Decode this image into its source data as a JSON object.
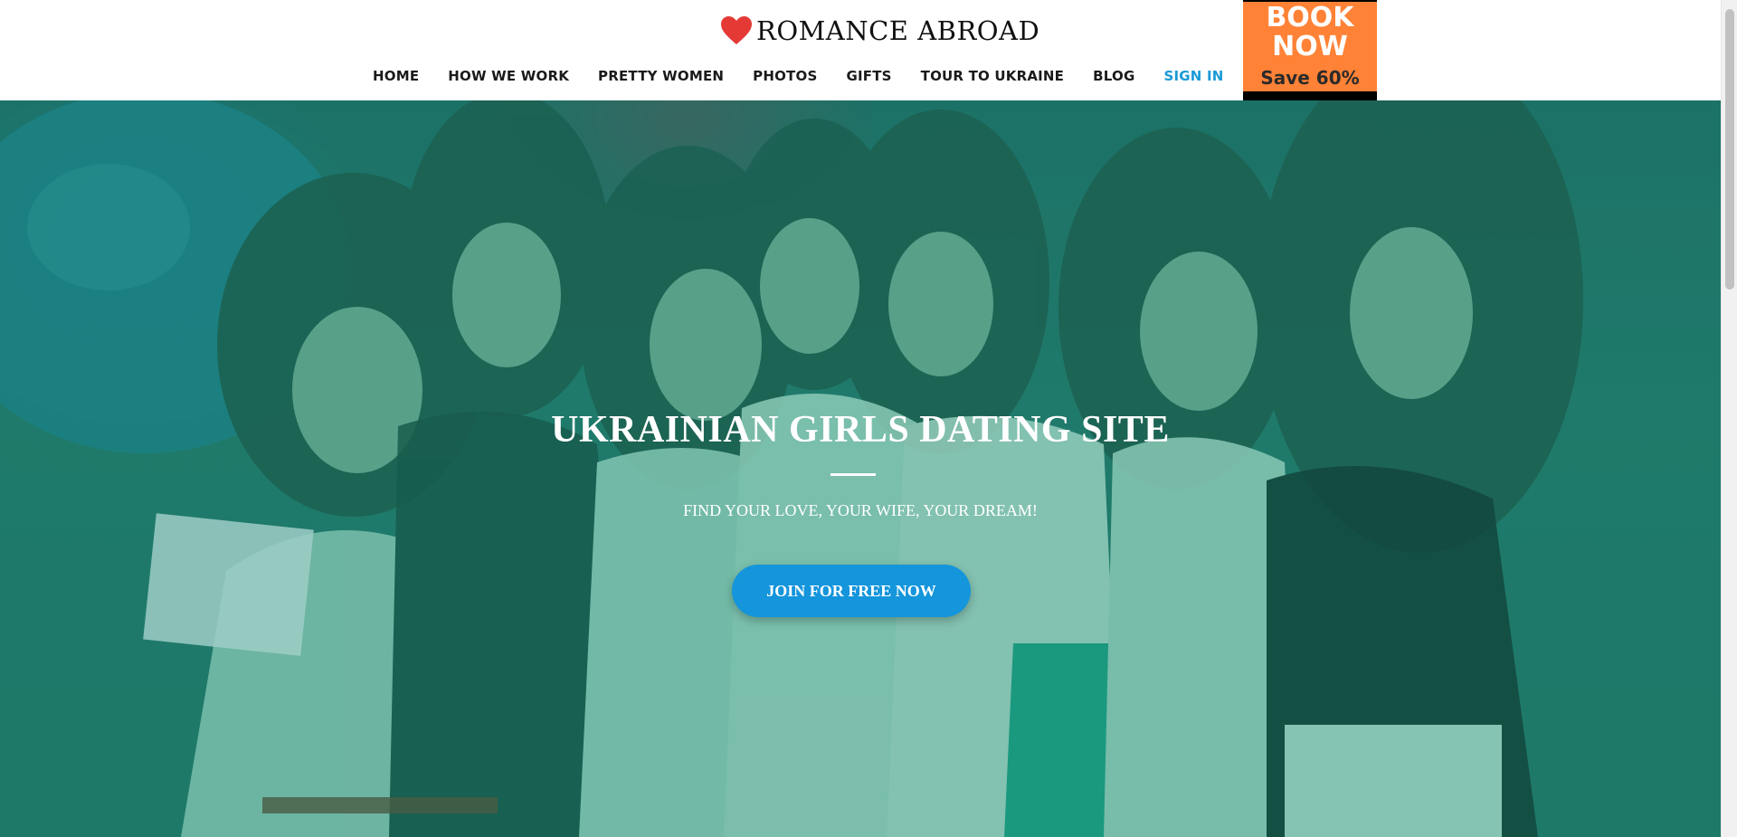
{
  "header": {
    "logo_text": "ROMANCE ABROAD",
    "nav": [
      {
        "label": "HOME"
      },
      {
        "label": "HOW WE WORK"
      },
      {
        "label": "PRETTY WOMEN"
      },
      {
        "label": "PHOTOS"
      },
      {
        "label": "GIFTS"
      },
      {
        "label": "TOUR TO UKRAINE"
      },
      {
        "label": "BLOG"
      },
      {
        "label": "SIGN IN"
      }
    ],
    "promo": {
      "line1": "BOOK",
      "line2": "NOW",
      "save": "Save 60%"
    }
  },
  "hero": {
    "title": "UKRAINIAN GIRLS DATING SITE",
    "subtitle": "FIND YOUR LOVE, YOUR WIFE, YOUR DREAM!",
    "cta": "JOIN FOR FREE NOW"
  },
  "colors": {
    "accent": "#1495dc",
    "signin": "#1a9ad6",
    "promo": "#ff8236",
    "heart": "#e53935",
    "overlay": "#1c8c73"
  }
}
